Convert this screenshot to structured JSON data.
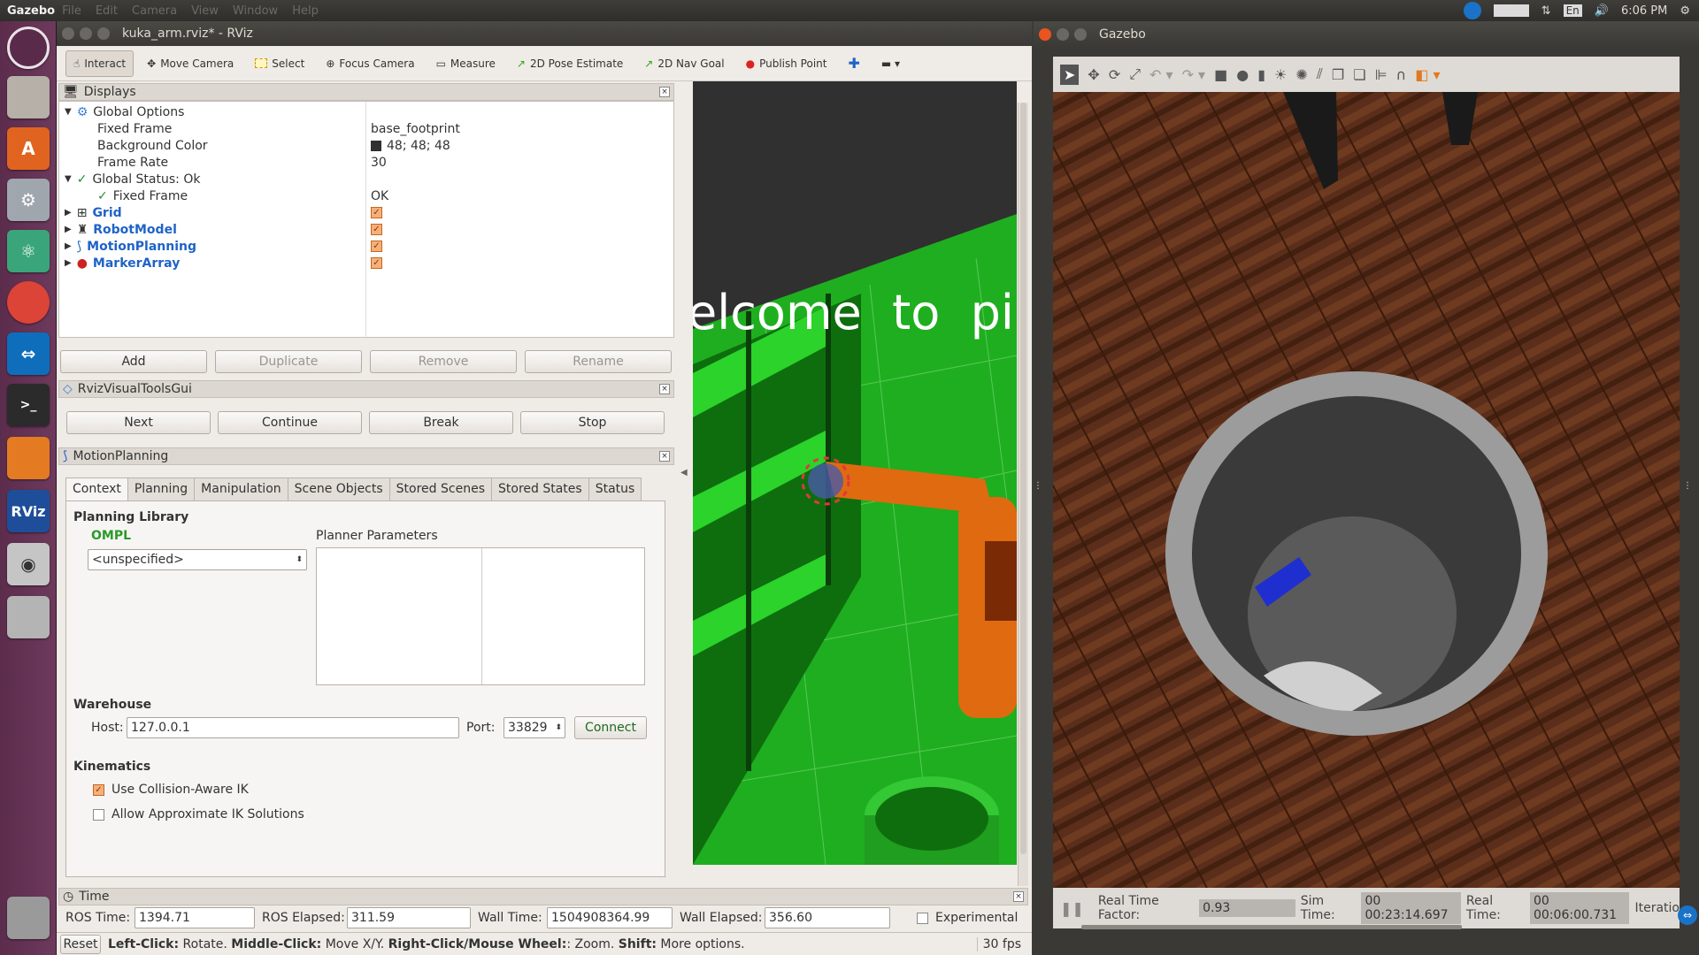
{
  "topbar": {
    "app": "Gazebo",
    "menus": [
      "File",
      "Edit",
      "Camera",
      "View",
      "Window",
      "Help"
    ],
    "time": "6:06 PM",
    "lang": "En"
  },
  "rviz": {
    "title": "kuka_arm.rviz* - RViz",
    "toolbar": [
      "Interact",
      "Move Camera",
      "Select",
      "Focus Camera",
      "Measure",
      "2D Pose Estimate",
      "2D Nav Goal",
      "Publish Point"
    ],
    "displays": {
      "header": "Displays",
      "global_options": "Global Options",
      "fixed_frame_label": "Fixed Frame",
      "fixed_frame_value": "base_footprint",
      "bg_color_label": "Background Color",
      "bg_color_value": "48; 48; 48",
      "frame_rate_label": "Frame Rate",
      "frame_rate_value": "30",
      "global_status": "Global Status: Ok",
      "status_fixed_frame": "Fixed Frame",
      "status_ok": "OK",
      "items": [
        "Grid",
        "RobotModel",
        "MotionPlanning",
        "MarkerArray"
      ],
      "buttons": [
        "Add",
        "Duplicate",
        "Remove",
        "Rename"
      ]
    },
    "visual_tools": {
      "header": "RvizVisualToolsGui",
      "buttons": [
        "Next",
        "Continue",
        "Break",
        "Stop"
      ]
    },
    "motion": {
      "header": "MotionPlanning",
      "tabs": [
        "Context",
        "Planning",
        "Manipulation",
        "Scene Objects",
        "Stored Scenes",
        "Stored States",
        "Status"
      ],
      "planning_library": "Planning Library",
      "ompl": "OMPL",
      "planner": "<unspecified>",
      "planner_params": "Planner Parameters",
      "warehouse": "Warehouse",
      "host_label": "Host:",
      "host": "127.0.0.1",
      "port_label": "Port:",
      "port": "33829",
      "connect": "Connect",
      "kinematics": "Kinematics",
      "collision_ik": "Use Collision-Aware IK",
      "approx_ik": "Allow Approximate IK Solutions"
    },
    "time": {
      "header": "Time",
      "ros_time_label": "ROS Time:",
      "ros_time": "1394.71",
      "ros_elapsed_label": "ROS Elapsed:",
      "ros_elapsed": "311.59",
      "wall_time_label": "Wall Time:",
      "wall_time": "1504908364.99",
      "wall_elapsed_label": "Wall Elapsed:",
      "wall_elapsed": "356.60",
      "experimental": "Experimental"
    },
    "status": {
      "reset": "Reset",
      "hint_a": "Left-Click:",
      "hint_a2": " Rotate. ",
      "hint_b": "Middle-Click:",
      "hint_b2": " Move X/Y. ",
      "hint_c": "Right-Click/Mouse Wheel:",
      "hint_c2": ": Zoom. ",
      "hint_d": "Shift:",
      "hint_d2": " More options.",
      "fps": "30 fps"
    },
    "view_text": "elcome  to  pi"
  },
  "gazebo": {
    "title": "Gazebo",
    "rtf_label": "Real Time Factor:",
    "rtf": "0.93",
    "sim_label": "Sim Time:",
    "sim": "00 00:23:14.697",
    "real_label": "Real Time:",
    "real": "00 00:06:00.731",
    "iter_label": "Iteratio"
  }
}
